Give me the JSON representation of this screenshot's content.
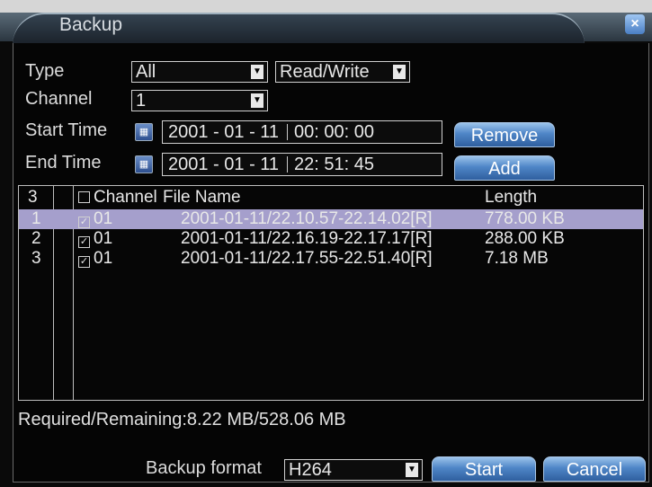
{
  "window": {
    "title": "Backup",
    "close_glyph": "×"
  },
  "filters": {
    "type_label": "Type",
    "type_value": "All",
    "mode_value": "Read/Write",
    "channel_label": "Channel",
    "channel_value": "1",
    "start_label": "Start Time",
    "start_date": "2001 - 01 - 11",
    "start_time": "00: 00: 00",
    "end_label": "End Time",
    "end_date": "2001 - 01 - 11",
    "end_time": "22: 51: 45"
  },
  "buttons": {
    "remove": "Remove",
    "add": "Add",
    "start": "Start",
    "cancel": "Cancel"
  },
  "table": {
    "count": "3",
    "headers": {
      "channel": "Channel",
      "file_name": "File Name",
      "length": "Length"
    },
    "rows": [
      {
        "index": "1",
        "channel": "01",
        "file": "2001-01-11/22.10.57-22.14.02[R]",
        "length": "778.00 KB"
      },
      {
        "index": "2",
        "channel": "01",
        "file": "2001-01-11/22.16.19-22.17.17[R]",
        "length": "288.00 KB"
      },
      {
        "index": "3",
        "channel": "01",
        "file": "2001-01-11/22.17.55-22.51.40[R]",
        "length": "7.18 MB"
      }
    ]
  },
  "summary": "Required/Remaining:8.22 MB/528.06 MB",
  "backup_format": {
    "label": "Backup format",
    "value": "H264"
  }
}
